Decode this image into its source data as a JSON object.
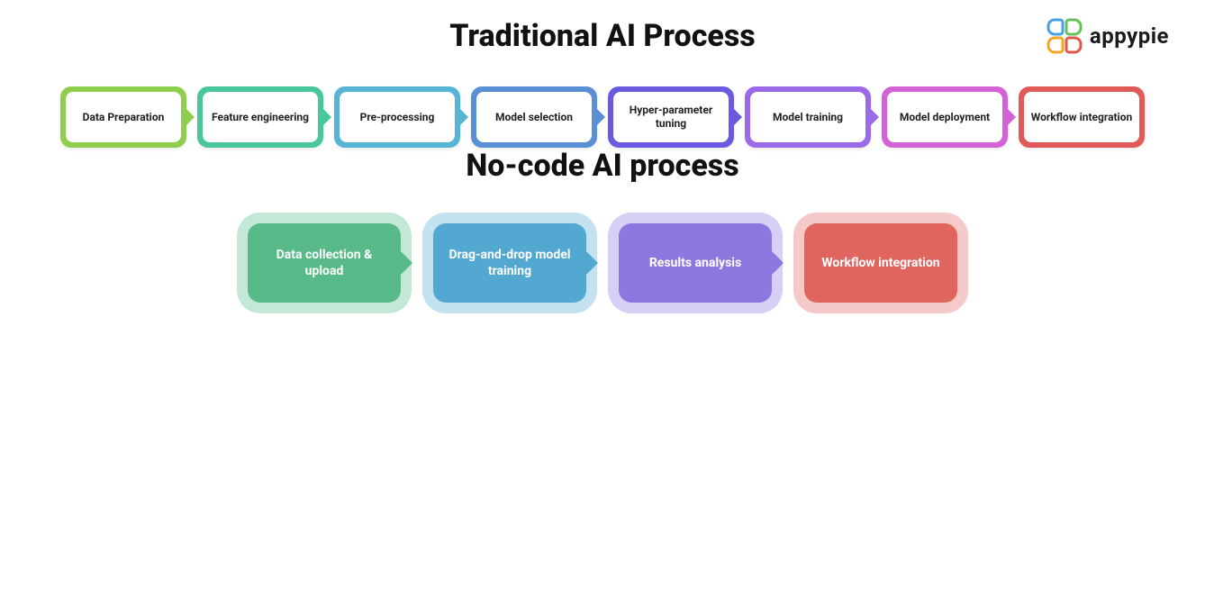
{
  "brand": {
    "name": "appypie",
    "logo_colors": {
      "tl": "#45a1e6",
      "tr": "#63c155",
      "bl": "#f6a623",
      "br": "#e2574c"
    }
  },
  "titles": {
    "traditional": "Traditional AI Process",
    "nocode": "No-code AI process"
  },
  "traditional_steps": [
    {
      "label": "Data Preparation",
      "color": "#8fce4d",
      "notch": "#8fce4d"
    },
    {
      "label": "Feature engineering",
      "color": "#47c79a",
      "notch": "#47c79a"
    },
    {
      "label": "Pre-processing",
      "color": "#56b4d4",
      "notch": "#56b4d4"
    },
    {
      "label": "Model selection",
      "color": "#5a8fd6",
      "notch": "#5a8fd6"
    },
    {
      "label": "Hyper-parameter tuning",
      "color": "#6a5ae0",
      "notch": "#6a5ae0"
    },
    {
      "label": "Model training",
      "color": "#9b6ae8",
      "notch": "#9b6ae8"
    },
    {
      "label": "Model deployment",
      "color": "#d262d6",
      "notch": "#d262d6"
    },
    {
      "label": "Workflow integration",
      "color": "#e15a57",
      "notch": "#e15a57"
    }
  ],
  "nocode_steps": [
    {
      "label": "Data collection & upload",
      "bg": "#58b989",
      "glow": "rgba(88,185,137,0.35)"
    },
    {
      "label": "Drag-and-drop model training",
      "bg": "#52a8d1",
      "glow": "rgba(82,168,209,0.35)"
    },
    {
      "label": "Results analysis",
      "bg": "#8d78e0",
      "glow": "rgba(141,120,224,0.35)"
    },
    {
      "label": "Workflow integration",
      "bg": "#e0655f",
      "glow": "rgba(224,101,95,0.35)"
    }
  ]
}
